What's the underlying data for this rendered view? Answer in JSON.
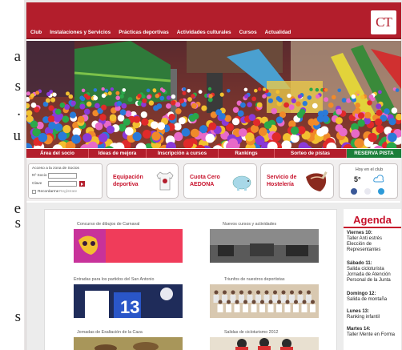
{
  "left_fragments": [
    "a",
    "s",
    ".",
    "u",
    "e",
    "s",
    "s"
  ],
  "header": {
    "nav": [
      "Club",
      "Instalaciones y Servicios",
      "Prácticas deportivas",
      "Actividades culturales",
      "Cursos",
      "Actualidad"
    ],
    "logo_text": "CT"
  },
  "menu2": [
    "Área del socio",
    "Ideas de mejora",
    "Inscripción a cursos",
    "Rankings",
    "Sorteo de pistas",
    "RESERVA PISTA"
  ],
  "login": {
    "title": "Acceso a la zona de Socios",
    "socio_label": "Nº Socio",
    "clave_label": "Clave",
    "remember_label": "Recordarme",
    "register_link": "Regístrate"
  },
  "promos": [
    {
      "line1": "Equipación",
      "line2": "deportiva"
    },
    {
      "line1": "Cuota Cero",
      "line2": "AEDONA"
    },
    {
      "line1": "Servicio de",
      "line2": "Hostelería"
    }
  ],
  "weather": {
    "title": "Hoy en el club",
    "temp": "5°"
  },
  "gallery": [
    {
      "caption": "Concurso de dibujos de Carnaval"
    },
    {
      "caption": "Nuevos cursos y actividades"
    },
    {
      "caption": "Entradas para los partidos del San Antonio"
    },
    {
      "caption": "Triunfos de nuestros deportistas"
    },
    {
      "caption": "Jornadas de Exaltación de la Caza"
    },
    {
      "caption": "Salidas de cicloturismo 2012"
    }
  ],
  "agenda": {
    "title": "Agenda",
    "items": [
      {
        "day": "Viernes 10:",
        "lines": [
          "Taller Anti estrés",
          "Elección de",
          "Representantes"
        ]
      },
      {
        "day": "Sábado 11:",
        "lines": [
          "Salida cicloturista",
          "Jornada de Atención",
          "Personal de la Junta"
        ]
      },
      {
        "day": "Domingo 12:",
        "lines": [
          "Salida de montaña"
        ]
      },
      {
        "day": "Lunes 13:",
        "lines": [
          "Ranking infantil"
        ]
      },
      {
        "day": "Martes 14:",
        "lines": [
          "Taller Mente en Forma"
        ]
      }
    ]
  },
  "colors": {
    "brand_red": "#b31e2c",
    "accent_red": "#c7112b",
    "green": "#1b7f3a"
  }
}
